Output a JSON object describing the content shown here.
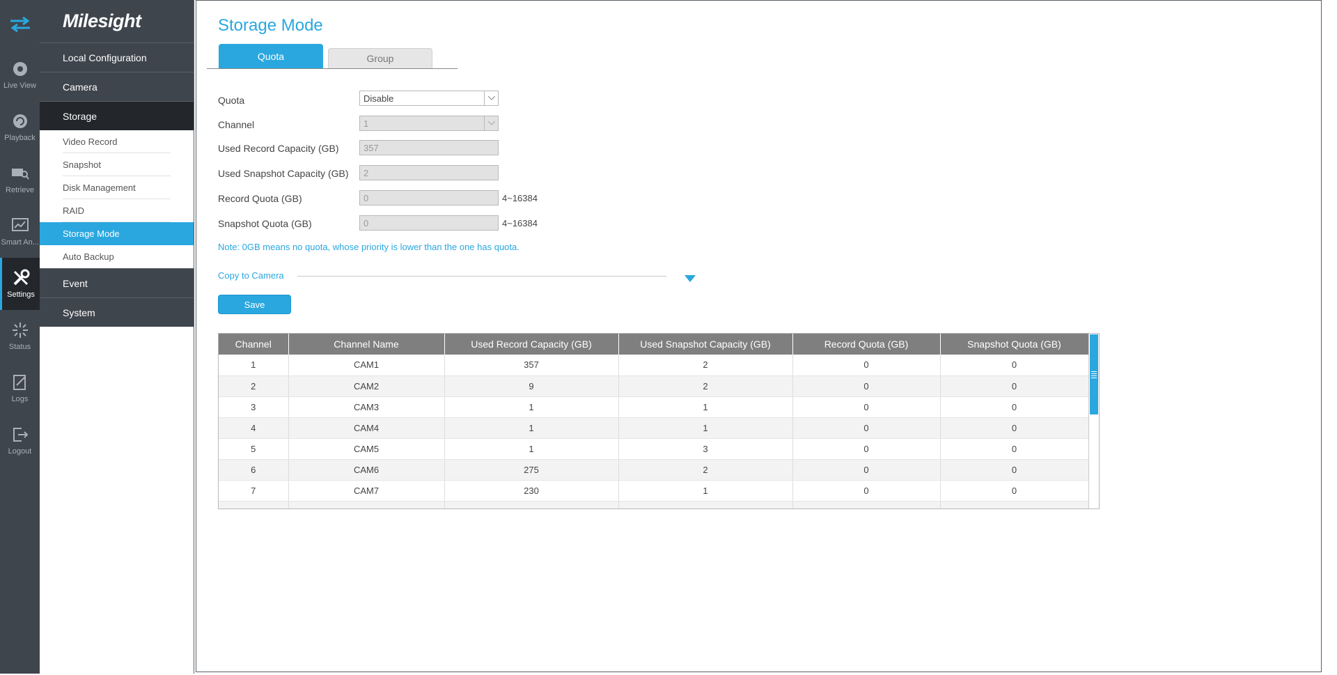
{
  "rail": {
    "items": [
      {
        "label": "Live View",
        "icon": "live-view-icon"
      },
      {
        "label": "Playback",
        "icon": "playback-icon"
      },
      {
        "label": "Retrieve",
        "icon": "retrieve-icon"
      },
      {
        "label": "Smart An...",
        "icon": "smart-analysis-icon"
      },
      {
        "label": "Settings",
        "icon": "settings-icon",
        "active": true
      },
      {
        "label": "Status",
        "icon": "status-icon"
      },
      {
        "label": "Logs",
        "icon": "logs-icon"
      },
      {
        "label": "Logout",
        "icon": "logout-icon"
      }
    ]
  },
  "sidebar": {
    "logo": "Milesight",
    "menu": {
      "local_configuration": "Local Configuration",
      "camera": "Camera",
      "storage": "Storage",
      "storage_items": [
        "Video Record",
        "Snapshot",
        "Disk Management",
        "RAID",
        "Storage Mode",
        "Auto Backup"
      ],
      "event": "Event",
      "system": "System"
    }
  },
  "page": {
    "title": "Storage Mode",
    "tabs": {
      "quota": "Quota",
      "group": "Group"
    },
    "form": {
      "quota_label": "Quota",
      "quota_value": "Disable",
      "channel_label": "Channel",
      "channel_value": "1",
      "used_record_label": "Used Record Capacity (GB)",
      "used_record_value": "357",
      "used_snapshot_label": "Used Snapshot Capacity (GB)",
      "used_snapshot_value": "2",
      "record_quota_label": "Record Quota (GB)",
      "record_quota_value": "0",
      "record_quota_range": "4~16384",
      "snapshot_quota_label": "Snapshot Quota (GB)",
      "snapshot_quota_value": "0",
      "snapshot_quota_range": "4~16384"
    },
    "note": "Note: 0GB means no quota, whose priority is lower than the one has quota.",
    "copy_to_camera": "Copy to Camera",
    "save": "Save"
  },
  "table": {
    "headers": [
      "Channel",
      "Channel Name",
      "Used Record Capacity (GB)",
      "Used Snapshot Capacity (GB)",
      "Record Quota (GB)",
      "Snapshot Quota (GB)"
    ],
    "rows": [
      [
        "1",
        "CAM1",
        "357",
        "2",
        "0",
        "0"
      ],
      [
        "2",
        "CAM2",
        "9",
        "2",
        "0",
        "0"
      ],
      [
        "3",
        "CAM3",
        "1",
        "1",
        "0",
        "0"
      ],
      [
        "4",
        "CAM4",
        "1",
        "1",
        "0",
        "0"
      ],
      [
        "5",
        "CAM5",
        "1",
        "3",
        "0",
        "0"
      ],
      [
        "6",
        "CAM6",
        "275",
        "2",
        "0",
        "0"
      ],
      [
        "7",
        "CAM7",
        "230",
        "1",
        "0",
        "0"
      ]
    ]
  },
  "colors": {
    "accent": "#2aa7df",
    "rail": "#3f454d",
    "rail_active": "#23272c"
  }
}
